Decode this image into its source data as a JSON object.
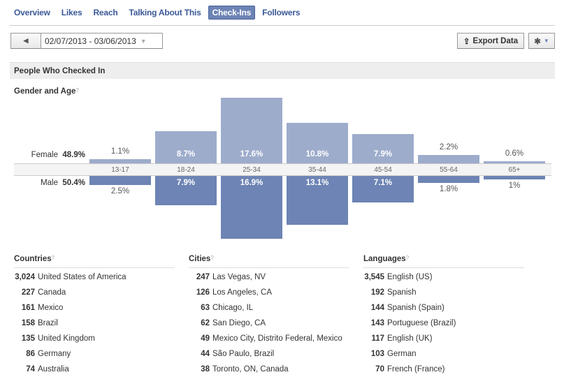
{
  "tabs": [
    "Overview",
    "Likes",
    "Reach",
    "Talking About This",
    "Check-Ins",
    "Followers"
  ],
  "active_tab": "Check-Ins",
  "toolbar": {
    "date_range": "02/07/2013 - 03/06/2013",
    "export_label": "Export Data",
    "prev_icon": "triangle-left-icon",
    "settings_icon": "gear-icon"
  },
  "section_title": "People Who Checked In",
  "chart_data": {
    "type": "bar",
    "title": "Gender and Age",
    "categories": [
      "13-17",
      "18-24",
      "25-34",
      "35-44",
      "45-54",
      "55-64",
      "65+"
    ],
    "series": [
      {
        "name": "Female",
        "total": "48.9%",
        "values": [
          1.1,
          8.7,
          17.6,
          10.8,
          7.9,
          2.2,
          0.6
        ],
        "labels": [
          "1.1%",
          "8.7%",
          "17.6%",
          "10.8%",
          "7.9%",
          "2.2%",
          "0.6%"
        ],
        "color": "#9daccb"
      },
      {
        "name": "Male",
        "total": "50.4%",
        "values": [
          2.5,
          7.9,
          16.9,
          13.1,
          7.1,
          1.8,
          1
        ],
        "labels": [
          "2.5%",
          "7.9%",
          "16.9%",
          "13.1%",
          "7.1%",
          "1.8%",
          "1%"
        ],
        "color": "#6d84b4"
      }
    ]
  },
  "lists": [
    {
      "title": "Countries",
      "rows": [
        [
          "3,024",
          "United States of America"
        ],
        [
          "227",
          "Canada"
        ],
        [
          "161",
          "Mexico"
        ],
        [
          "158",
          "Brazil"
        ],
        [
          "135",
          "United Kingdom"
        ],
        [
          "86",
          "Germany"
        ],
        [
          "74",
          "Australia"
        ]
      ]
    },
    {
      "title": "Cities",
      "rows": [
        [
          "247",
          "Las Vegas, NV"
        ],
        [
          "126",
          "Los Angeles, CA"
        ],
        [
          "63",
          "Chicago, IL"
        ],
        [
          "62",
          "San Diego, CA"
        ],
        [
          "49",
          "Mexico City, Distrito Federal, Mexico"
        ],
        [
          "44",
          "São Paulo, Brazil"
        ],
        [
          "38",
          "Toronto, ON, Canada"
        ]
      ]
    },
    {
      "title": "Languages",
      "rows": [
        [
          "3,545",
          "English (US)"
        ],
        [
          "192",
          "Spanish"
        ],
        [
          "144",
          "Spanish (Spain)"
        ],
        [
          "143",
          "Portuguese (Brazil)"
        ],
        [
          "117",
          "English (UK)"
        ],
        [
          "103",
          "German"
        ],
        [
          "70",
          "French (France)"
        ]
      ]
    }
  ],
  "help_mark": "?"
}
